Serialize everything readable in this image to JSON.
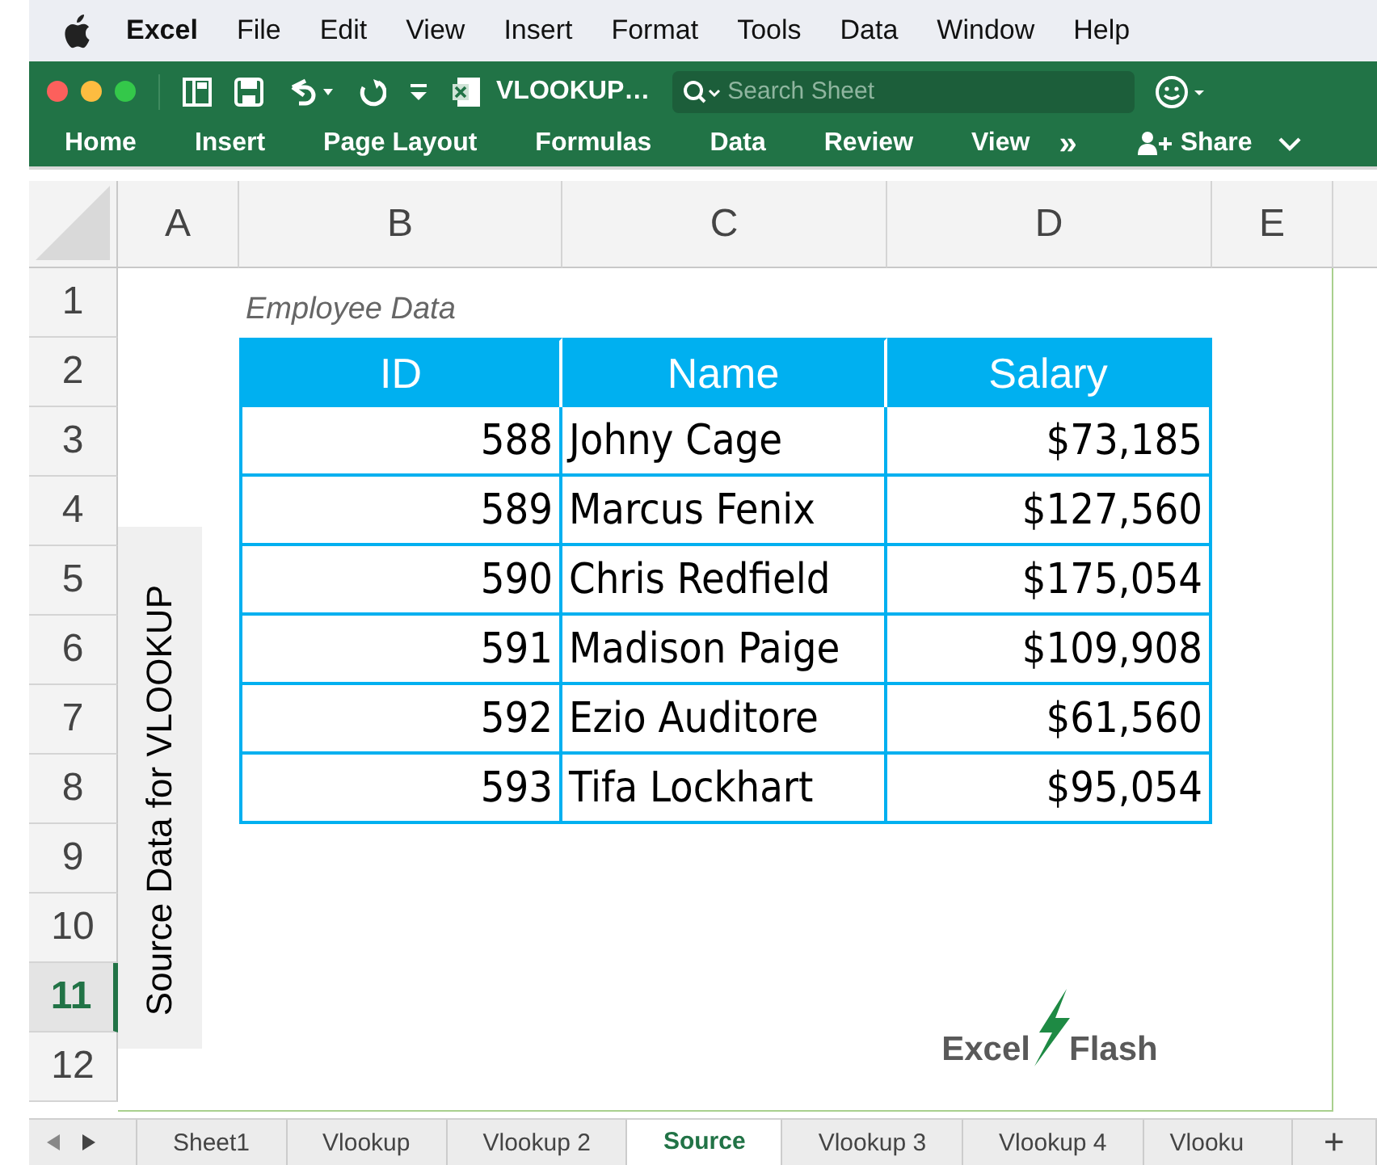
{
  "menu_bar": {
    "app": "Excel",
    "items": [
      "File",
      "Edit",
      "View",
      "Insert",
      "Format",
      "Tools",
      "Data",
      "Window",
      "Help"
    ]
  },
  "toolbar": {
    "document_title": "VLOOKUP…",
    "search": {
      "placeholder": "Search Sheet"
    }
  },
  "ribbon": {
    "tabs": [
      "Home",
      "Insert",
      "Page Layout",
      "Formulas",
      "Data",
      "Review",
      "View"
    ],
    "more": "»",
    "share": "Share"
  },
  "columns": [
    "A",
    "B",
    "C",
    "D",
    "E"
  ],
  "rows": [
    {
      "label": "1",
      "selected": false
    },
    {
      "label": "2",
      "selected": false
    },
    {
      "label": "3",
      "selected": false
    },
    {
      "label": "4",
      "selected": false
    },
    {
      "label": "5",
      "selected": false
    },
    {
      "label": "6",
      "selected": false
    },
    {
      "label": "7",
      "selected": false
    },
    {
      "label": "8",
      "selected": false
    },
    {
      "label": "9",
      "selected": false
    },
    {
      "label": "10",
      "selected": false
    },
    {
      "label": "11",
      "selected": true
    },
    {
      "label": "12",
      "selected": false
    }
  ],
  "sheet": {
    "caption": "Employee Data",
    "side_label": "Source Data for VLOOKUP",
    "table": {
      "columns": [
        "ID",
        "Name",
        "Salary"
      ],
      "rows": [
        [
          "588",
          "Johny Cage",
          "$73,185"
        ],
        [
          "589",
          "Marcus Fenix",
          "$127,560"
        ],
        [
          "590",
          "Chris Redfield",
          "$175,054"
        ],
        [
          "591",
          "Madison Paige",
          "$109,908"
        ],
        [
          "592",
          "Ezio Auditore",
          "$61,560"
        ],
        [
          "593",
          "Tifa Lockhart",
          "$95,054"
        ]
      ]
    },
    "logo": {
      "left": "Excel",
      "right": "Flash"
    }
  },
  "sheet_tabs": [
    {
      "label": "Sheet1",
      "selected": false
    },
    {
      "label": "Vlookup",
      "selected": false
    },
    {
      "label": "Vlookup 2",
      "selected": false
    },
    {
      "label": "Source",
      "selected": true
    },
    {
      "label": "Vlookup 3",
      "selected": false
    },
    {
      "label": "Vlookup 4",
      "selected": false
    },
    {
      "label": "Vlooku",
      "selected": false
    }
  ],
  "add_tab": "+"
}
